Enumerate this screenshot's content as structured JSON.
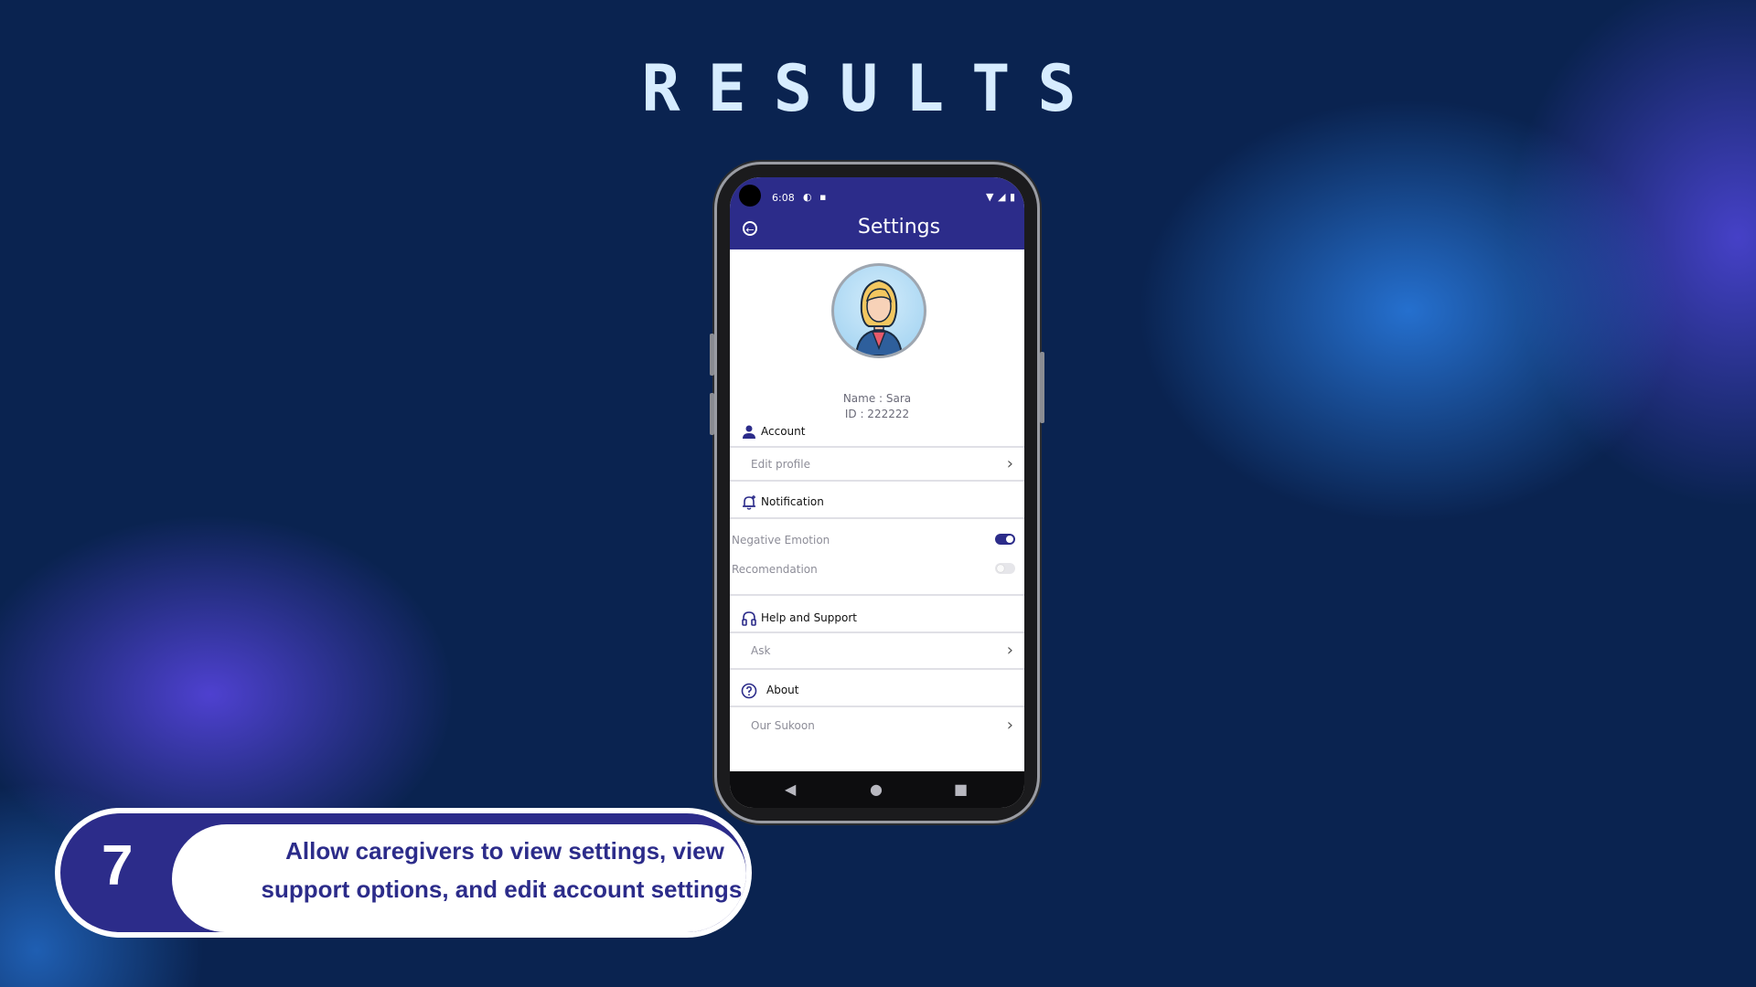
{
  "page": {
    "title": "RESULTS"
  },
  "status_bar": {
    "time": "6:08"
  },
  "app_bar": {
    "title": "Settings"
  },
  "profile": {
    "name_line": "Name : Sara",
    "id_line": "ID : 222222"
  },
  "sections": {
    "account": {
      "title": "Account",
      "edit_profile": "Edit profile"
    },
    "notification": {
      "title": "Notification",
      "negative_emotion": {
        "label": "Negative Emotion",
        "enabled": true
      },
      "recommendation": {
        "label": "Recomendation",
        "enabled": false
      }
    },
    "help": {
      "title": "Help and Support",
      "ask": "Ask"
    },
    "about": {
      "title": "About",
      "our_sukoon": "Our Sukoon"
    }
  },
  "caption": {
    "number": "7",
    "text": "Allow caregivers to view settings, view support options, and edit account settings."
  },
  "colors": {
    "accent": "#2c2c8a",
    "title": "#d6ecff",
    "background": "#0a2350"
  }
}
